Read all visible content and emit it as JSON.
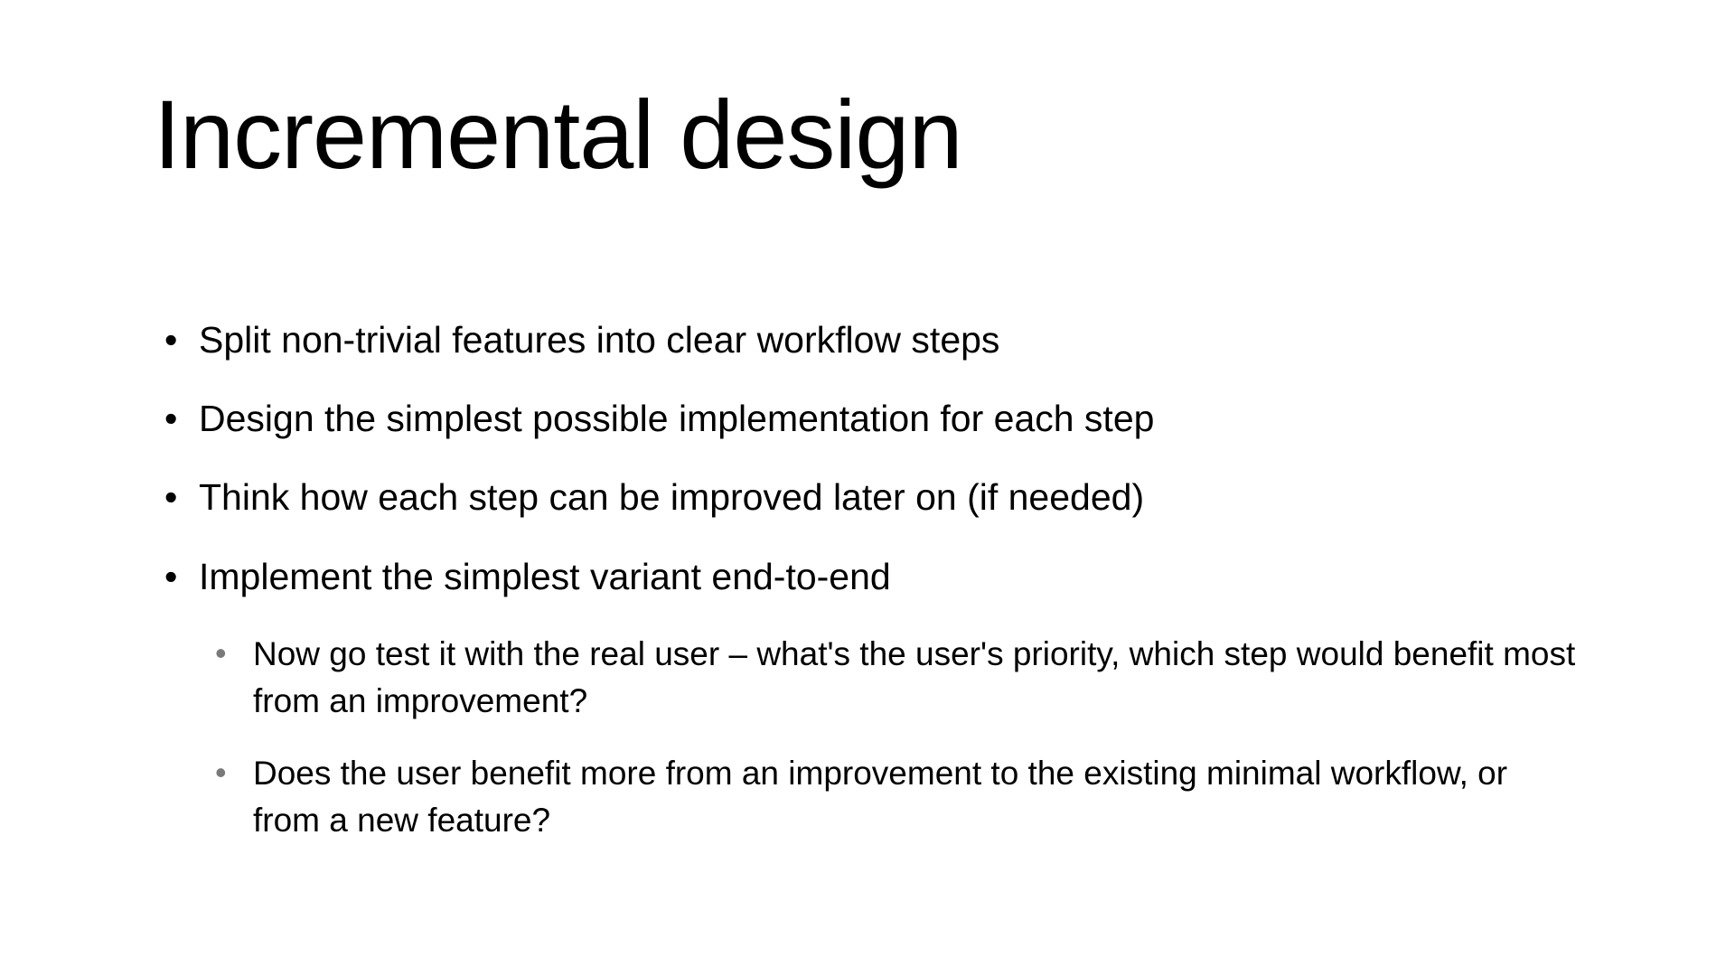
{
  "slide": {
    "title": "Incremental design",
    "bullets": [
      {
        "text": "Split non-trivial features into clear workflow steps"
      },
      {
        "text": "Design the simplest possible implementation for each step"
      },
      {
        "text": "Think how each step can be improved later on (if needed)"
      },
      {
        "text": "Implement the simplest variant end-to-end",
        "sub": [
          "Now go test it with the real user – what's the user's priority, which step would benefit most from an improvement?",
          "Does the user benefit more from an improvement to the existing minimal workflow, or from a new feature?"
        ]
      }
    ]
  }
}
